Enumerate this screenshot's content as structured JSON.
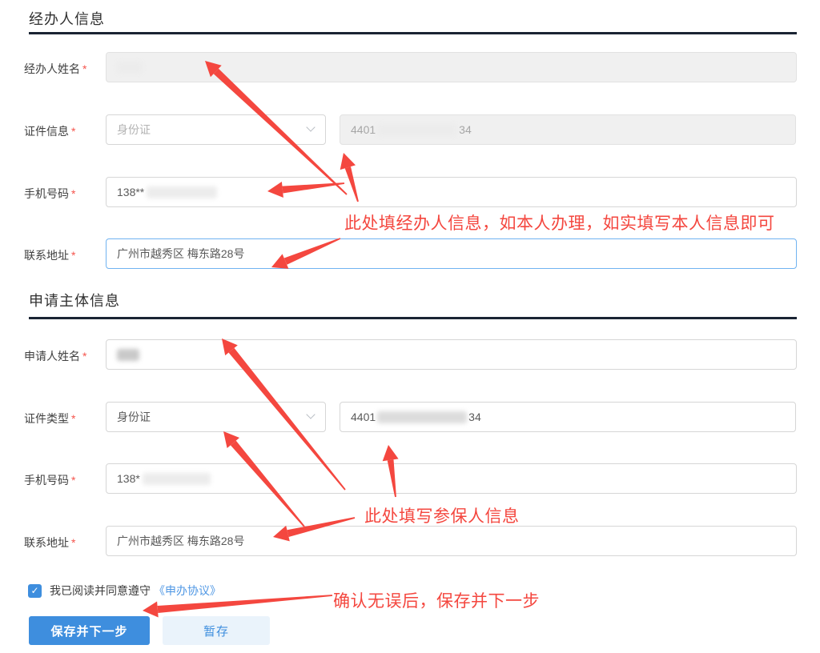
{
  "misc": {
    "required_marker": "*",
    "check_glyph": "✓"
  },
  "colors": {
    "annotation_red": "#f4473f",
    "primary_blue": "#3e8ede",
    "secondary_button_bg": "#eaf3fb",
    "link_blue": "#4f97e4",
    "section_rule": "#1a2433",
    "focus_border": "#70b3f1"
  },
  "agent_section": {
    "title": "经办人信息",
    "name": {
      "label": "经办人姓名",
      "redacted": true
    },
    "cert": {
      "label": "证件信息",
      "select_value": "身份证",
      "id_prefix": "4401",
      "id_suffix": "34",
      "redacted_middle": true
    },
    "phone": {
      "label": "手机号码",
      "value_prefix": "138**",
      "redacted_rest": true
    },
    "address": {
      "label": "联系地址",
      "value": "广州市越秀区 梅东路28号"
    }
  },
  "applicant_section": {
    "title": "申请主体信息",
    "name": {
      "label": "申请人姓名",
      "redacted": true
    },
    "cert": {
      "label": "证件类型",
      "select_value": "身份证",
      "id_prefix": "4401",
      "id_suffix": "34",
      "redacted_middle": true
    },
    "phone": {
      "label": "手机号码",
      "value_prefix": "138*",
      "redacted_rest": true
    },
    "address": {
      "label": "联系地址",
      "value": "广州市越秀区 梅东路28号"
    }
  },
  "annotations": {
    "agent_note": "此处填经办人信息，如本人办理，如实填写本人信息即可",
    "applicant_note": "此处填写参保人信息",
    "confirm_note": "确认无误后，保存并下一步"
  },
  "agreement": {
    "checked": true,
    "text": "我已阅读并同意遵守",
    "link": "《申办协议》"
  },
  "buttons": {
    "save_next": "保存并下一步",
    "temp_save": "暂存"
  }
}
